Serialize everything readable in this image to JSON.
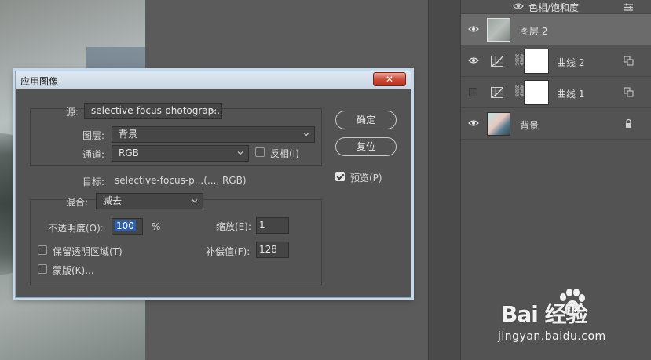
{
  "layers_panel": {
    "layers": [
      {
        "name": "色相/饱和度",
        "visible": true,
        "type": "adjustment-partial"
      },
      {
        "name": "图层 2",
        "visible": true,
        "type": "pixel",
        "selected": true
      },
      {
        "name": "曲线 2",
        "visible": true,
        "type": "curves"
      },
      {
        "name": "曲线 1",
        "visible": false,
        "type": "curves"
      },
      {
        "name": "背景",
        "visible": true,
        "type": "background",
        "locked": true
      }
    ]
  },
  "dialog": {
    "title": "应用图像",
    "close_label": "✕",
    "source_label": "源:",
    "source_value": "selective-focus-photograp...",
    "layer_label": "图层:",
    "layer_value": "背景",
    "channel_label": "通道:",
    "channel_value": "RGB",
    "invert_label": "反相(I)",
    "invert_checked": false,
    "target_label": "目标:",
    "target_value": "selective-focus-p...(..., RGB)",
    "blend_label": "混合:",
    "blend_value": "减去",
    "opacity_label": "不透明度(O):",
    "opacity_value": "100",
    "opacity_unit": "%",
    "scale_label": "缩放(E):",
    "scale_value": "1",
    "offset_label": "补偿值(F):",
    "offset_value": "128",
    "preserve_label": "保留透明区域(T)",
    "preserve_checked": false,
    "mask_label": "蒙版(K)...",
    "mask_checked": false,
    "ok_label": "确定",
    "reset_label": "复位",
    "preview_label": "预览(P)",
    "preview_checked": true
  },
  "watermark": {
    "brand": "Bai  经验",
    "url": "jingyan.baidu.com"
  },
  "colors": {
    "highlight": "#2f5fa8",
    "close": "#c8493a",
    "panel": "#535353"
  }
}
